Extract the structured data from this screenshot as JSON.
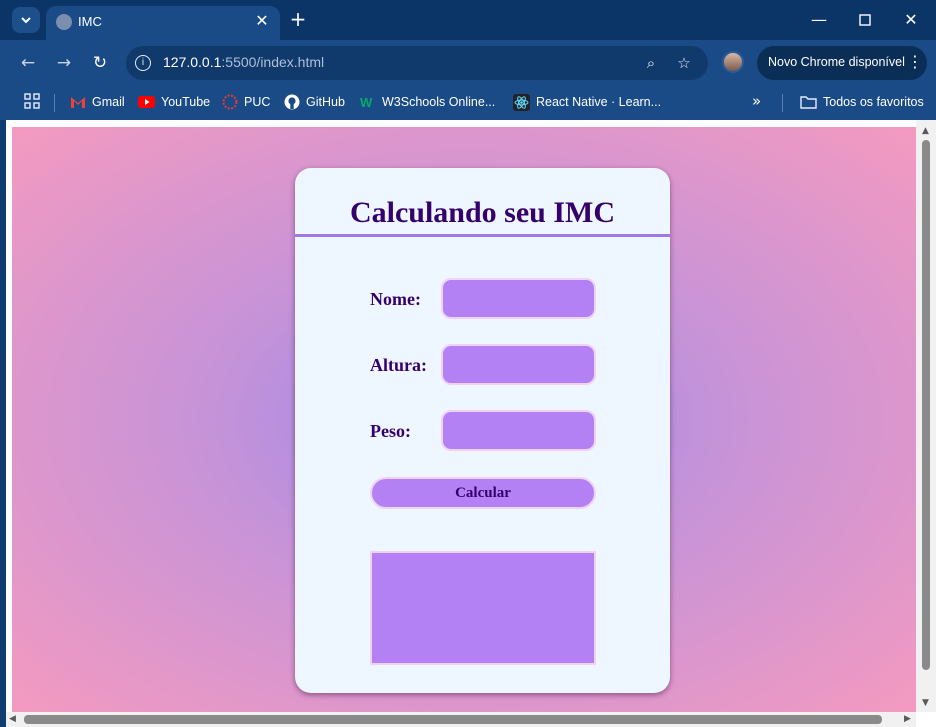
{
  "browser": {
    "tab": {
      "title": "IMC"
    },
    "url": {
      "host": "127.0.0.1",
      "rest": ":5500/index.html"
    },
    "update_chip": {
      "label": "Novo Chrome disponível"
    }
  },
  "bookmarks": {
    "items": [
      {
        "label": "Gmail",
        "icon": "gmail-icon",
        "color": "#ea4335"
      },
      {
        "label": "YouTube",
        "icon": "youtube-icon",
        "color": "#ff0000"
      },
      {
        "label": "PUC",
        "icon": "puc-icon",
        "color": "#e53935"
      },
      {
        "label": "GitHub",
        "icon": "github-icon",
        "color": "#ffffff"
      },
      {
        "label": "W3Schools Online...",
        "icon": "w3schools-icon",
        "color": "#04aa6d"
      },
      {
        "label": "React Native · Learn...",
        "icon": "react-icon",
        "color": "#61dafb"
      }
    ],
    "all_bookmarks": "Todos os favoritos"
  },
  "page": {
    "title": "Calculando seu IMC",
    "fields": [
      {
        "label": "Nome:",
        "value": ""
      },
      {
        "label": "Altura:",
        "value": ""
      },
      {
        "label": "Peso:",
        "value": ""
      }
    ],
    "button": "Calcular",
    "result": ""
  },
  "colors": {
    "card_bg": "#eef6ff",
    "title_color": "#35006b",
    "input_bg": "#b481f5",
    "gradient_center": "#9a86ea",
    "gradient_edge": "#f49ac0"
  }
}
